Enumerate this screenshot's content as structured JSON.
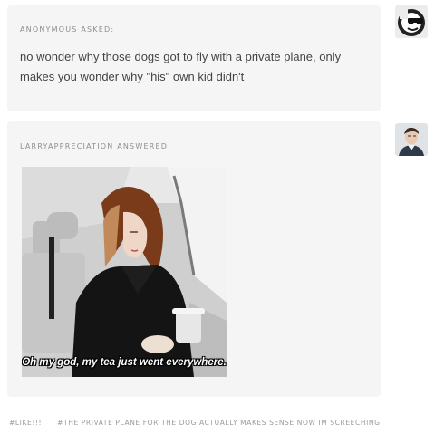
{
  "ask": {
    "asker": "ANONYMOUS",
    "verb": "ASKED:",
    "question": "no wonder why those dogs got to fly with a private plane, only makes you wonder why \"his\" own kid didn't",
    "avatar_icon": "sunglasses-smiley-icon"
  },
  "answer": {
    "responder": "LARRYAPPRECIATION",
    "verb": "ANSWERED:",
    "gif_caption": "Oh my god, my tea just went everywhere.",
    "avatar_icon": "user-photo-avatar"
  },
  "tags": [
    "#LIKE!!!",
    "#THE PRIVATE PLANE FOR THE DOG ACTUALLY MAKES SENSE NOW IM SCREECHING"
  ],
  "colors": {
    "card_bg": "#f5f5f5",
    "meta_text": "#8e8e8e",
    "body_text": "#444444"
  }
}
